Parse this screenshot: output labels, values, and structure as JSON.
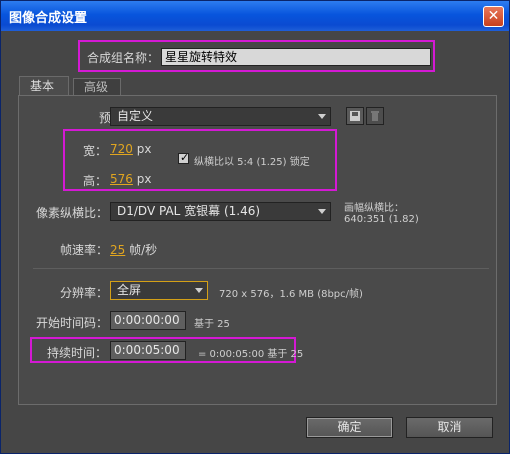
{
  "window": {
    "title": "图像合成设置"
  },
  "comp": {
    "name_label": "合成组名称：",
    "name_value": "星星旋转特效"
  },
  "tabs": [
    {
      "label": "基本"
    },
    {
      "label": "高级"
    }
  ],
  "preset": {
    "label": "预置：",
    "value": "自定义"
  },
  "width": {
    "label": "宽：",
    "value": "720",
    "unit": "px"
  },
  "height": {
    "label": "高：",
    "value": "576",
    "unit": "px"
  },
  "aspect_lock": {
    "label": "纵横比以 5:4 (1.25) 锁定",
    "checked": true
  },
  "pixel_aspect": {
    "label": "像素纵横比：",
    "value": "D1/DV PAL 宽银幕 (1.46)",
    "frame_label": "画幅纵横比：",
    "frame_value": "640:351 (1.82)"
  },
  "frame_rate": {
    "label": "帧速率：",
    "value": "25",
    "unit": "帧/秒"
  },
  "resolution": {
    "label": "分辨率：",
    "value": "全屏",
    "info": "720 x 576，1.6 MB (8bpc/帧)"
  },
  "start_timecode": {
    "label": "开始时间码：",
    "value": "0:00:00:00",
    "base": "基于 25"
  },
  "duration": {
    "label": "持续时间：",
    "value": "0:00:05:00",
    "info": "= 0:00:05:00  基于 25"
  },
  "buttons": {
    "ok": "确定",
    "cancel": "取消"
  },
  "colors": {
    "highlight": "#d419d4",
    "accent": "#e0a520",
    "titlebar": "#0a4bd1"
  }
}
